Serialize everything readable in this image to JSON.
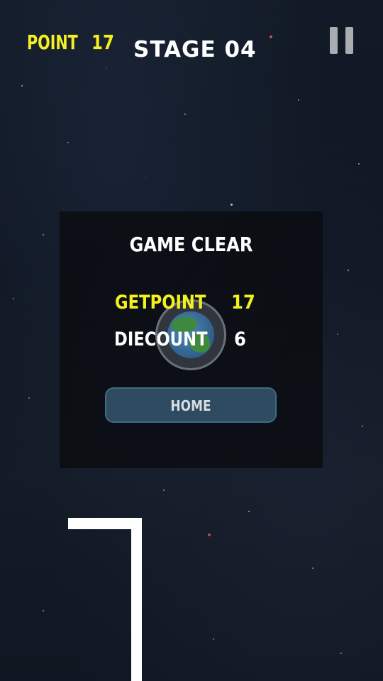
{
  "hud": {
    "point_label": "POINT",
    "point_value": "17",
    "stage": "STAGE 04",
    "pause_icon": "pause-icon"
  },
  "result_panel": {
    "title": "GAME CLEAR",
    "getpoint_label": "GETPOINT",
    "getpoint_value": "17",
    "diecount_label": "DIECOUNT",
    "diecount_value": "6",
    "home_button": "HOME",
    "planet_icon": "earth-icon"
  },
  "colors": {
    "point_yellow": "#f3f01e",
    "button_fill": "#2e4b61",
    "button_border": "#3f6a88"
  }
}
